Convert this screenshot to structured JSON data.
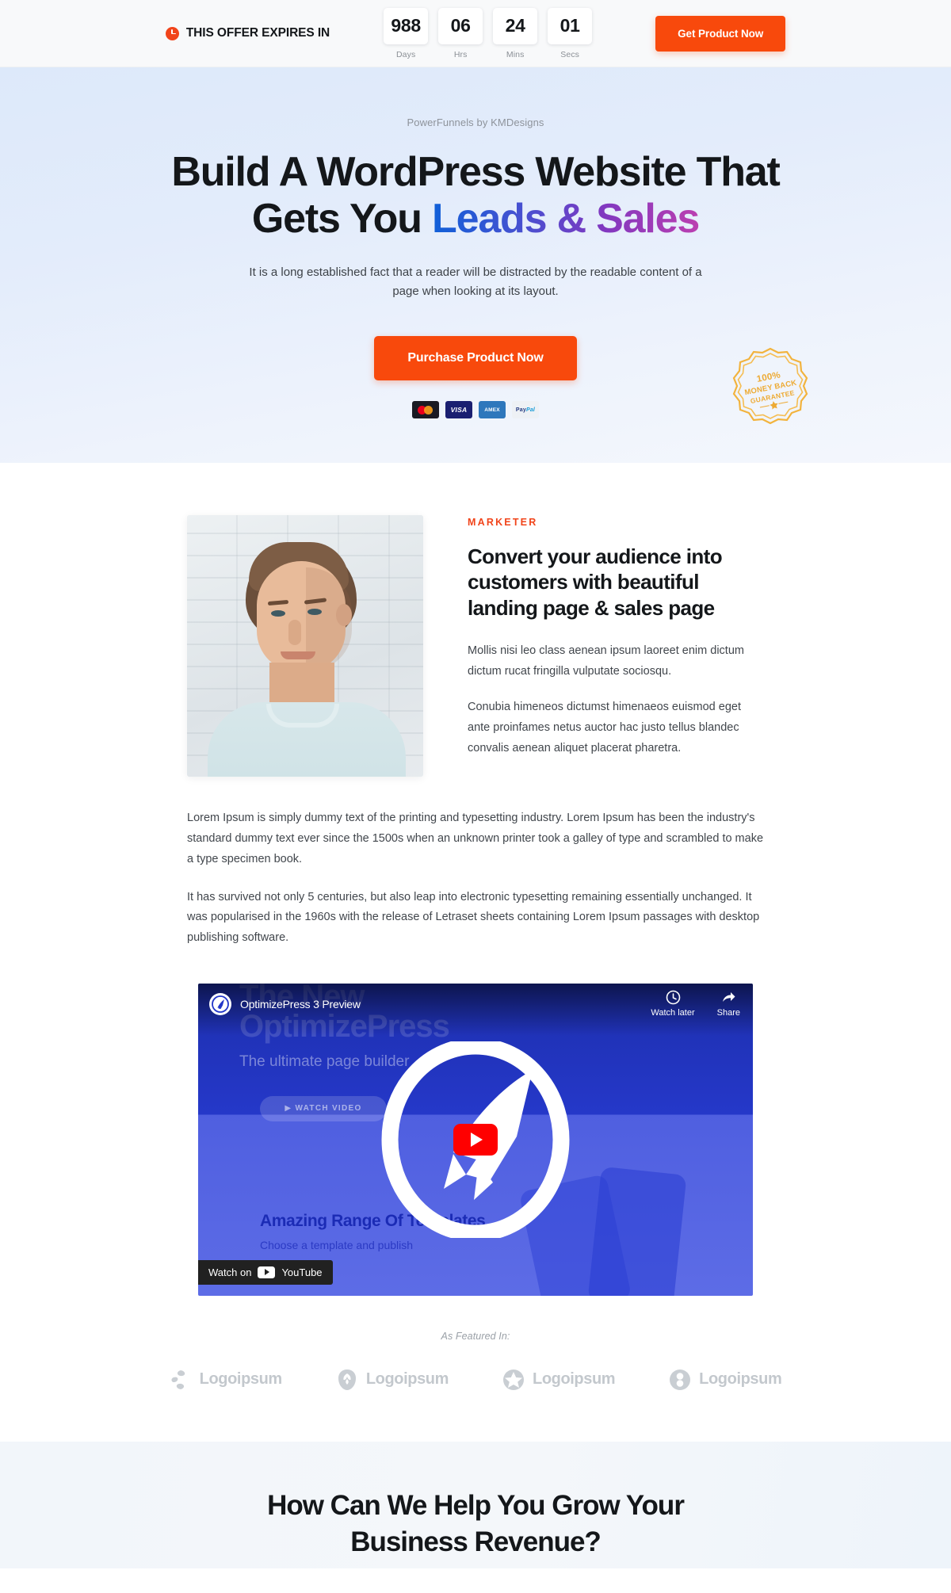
{
  "topbar": {
    "offer_label": "THIS OFFER EXPIRES IN",
    "clock_icon": "clock-icon",
    "cta_label": "Get Product Now",
    "counter": [
      {
        "value": "988",
        "label": "Days"
      },
      {
        "value": "06",
        "label": "Hrs"
      },
      {
        "value": "24",
        "label": "Mins"
      },
      {
        "value": "01",
        "label": "Secs"
      }
    ]
  },
  "hero": {
    "eyebrow": "PowerFunnels by KMDesigns",
    "headline_line1": "Build A WordPress Website That",
    "headline_line2_plain": "Gets You ",
    "headline_line2_gradient": "Leads & Sales",
    "subtext": "It is a long established fact that a reader will be distracted by the readable content of a page when looking at its layout.",
    "cta_label": "Purchase Product Now",
    "badge": {
      "line1": "100%",
      "line2": "MONEY BACK",
      "line3": "GUARANTEE"
    },
    "payment_cards": [
      {
        "name": "mastercard-icon",
        "label": ""
      },
      {
        "name": "visa-icon",
        "label": "VISA"
      },
      {
        "name": "amex-icon",
        "label": "AMEX"
      },
      {
        "name": "paypal-icon",
        "label": "PayPal"
      }
    ],
    "gradient_colors": [
      "#1060d8",
      "#4b4fd0",
      "#8038c0",
      "#bb3fb0"
    ],
    "accent_color": "#f8490c"
  },
  "marketer": {
    "kicker": "MARKETER",
    "heading": "Convert your audience into customers with beautiful landing page & sales page",
    "paragraph1": "Mollis nisi leo class aenean ipsum laoreet enim dictum dictum rucat fringilla vulputate sociosqu.",
    "paragraph2": "Conubia himeneos dictumst himenaeos euismod eget ante proinfames netus auctor hac justo tellus blandec convalis aenean aliquet placerat pharetra.",
    "portrait_alt": "portrait-photo"
  },
  "body_copy": {
    "paragraph1": "Lorem Ipsum is simply dummy text of the printing and typesetting industry. Lorem Ipsum has been the industry's standard dummy text ever since the 1500s when an unknown printer took a galley of type and scrambled to make a type specimen book.",
    "paragraph2": "It has survived not only 5 centuries, but also leap into electronic typesetting remaining essentially unchanged. It was popularised in the 1960s with the release of Letraset sheets containing Lorem Ipsum passages with desktop publishing software."
  },
  "video": {
    "channel_title": "OptimizePress 3 Preview",
    "watch_later_label": "Watch later",
    "share_label": "Share",
    "watch_on_label": "Watch on",
    "youtube_label": "YouTube",
    "overlay_title_1": "The New",
    "overlay_title_2": "OptimizePress",
    "overlay_subtitle": "The ultimate page builder",
    "overlay_button": "WATCH VIDEO",
    "overlay_heading": "Amazing Range Of Templates",
    "overlay_subheading": "Choose a template and publish"
  },
  "featured": {
    "label": "As Featured In:",
    "logos": [
      {
        "icon": "leaf-swirl-icon",
        "text": "Logoipsum"
      },
      {
        "icon": "flower-shield-icon",
        "text": "Logoipsum"
      },
      {
        "icon": "star-circle-icon",
        "text": "Logoipsum"
      },
      {
        "icon": "infinity-circle-icon",
        "text": "Logoipsum"
      }
    ]
  },
  "grow": {
    "heading_line1": "How Can We Help You Grow Your",
    "heading_line2": "Business Revenue?"
  }
}
